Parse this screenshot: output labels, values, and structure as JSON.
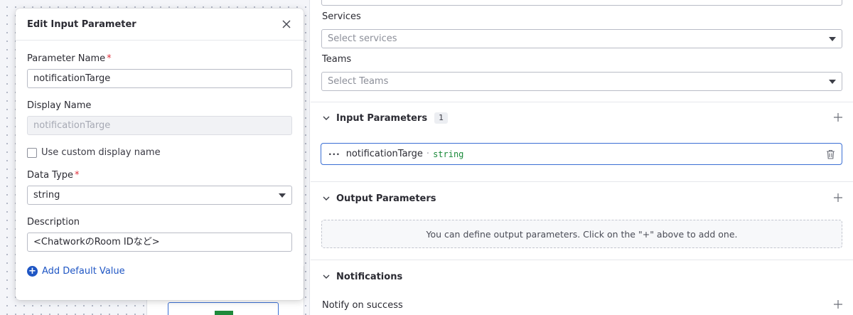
{
  "dialog": {
    "title": "Edit Input Parameter",
    "parameter_name_label": "Parameter Name",
    "required_mark": "*",
    "parameter_name_value": "notificationTarge",
    "display_name_label": "Display Name",
    "display_name_value": "notificationTarge",
    "custom_display_label": "Use custom display name",
    "data_type_label": "Data Type",
    "data_type_value": "string",
    "description_label": "Description",
    "description_value": "<ChatworkのRoom IDなど>",
    "add_default_label": "Add Default Value"
  },
  "panel": {
    "services_label": "Services",
    "services_placeholder": "Select services",
    "teams_label": "Teams",
    "teams_placeholder": "Select Teams",
    "input_section_title": "Input Parameters",
    "input_count": "1",
    "param_name": "notificationTarge",
    "param_separator": "·",
    "param_type": "string",
    "output_section_title": "Output Parameters",
    "output_empty_text": "You can define output parameters. Click on the \"+\" above to add one.",
    "notifications_title": "Notifications",
    "notify_success_label": "Notify on success"
  },
  "colors": {
    "accent": "#1f56c4",
    "required": "#e0303c",
    "type_text": "#1a8a3a"
  }
}
